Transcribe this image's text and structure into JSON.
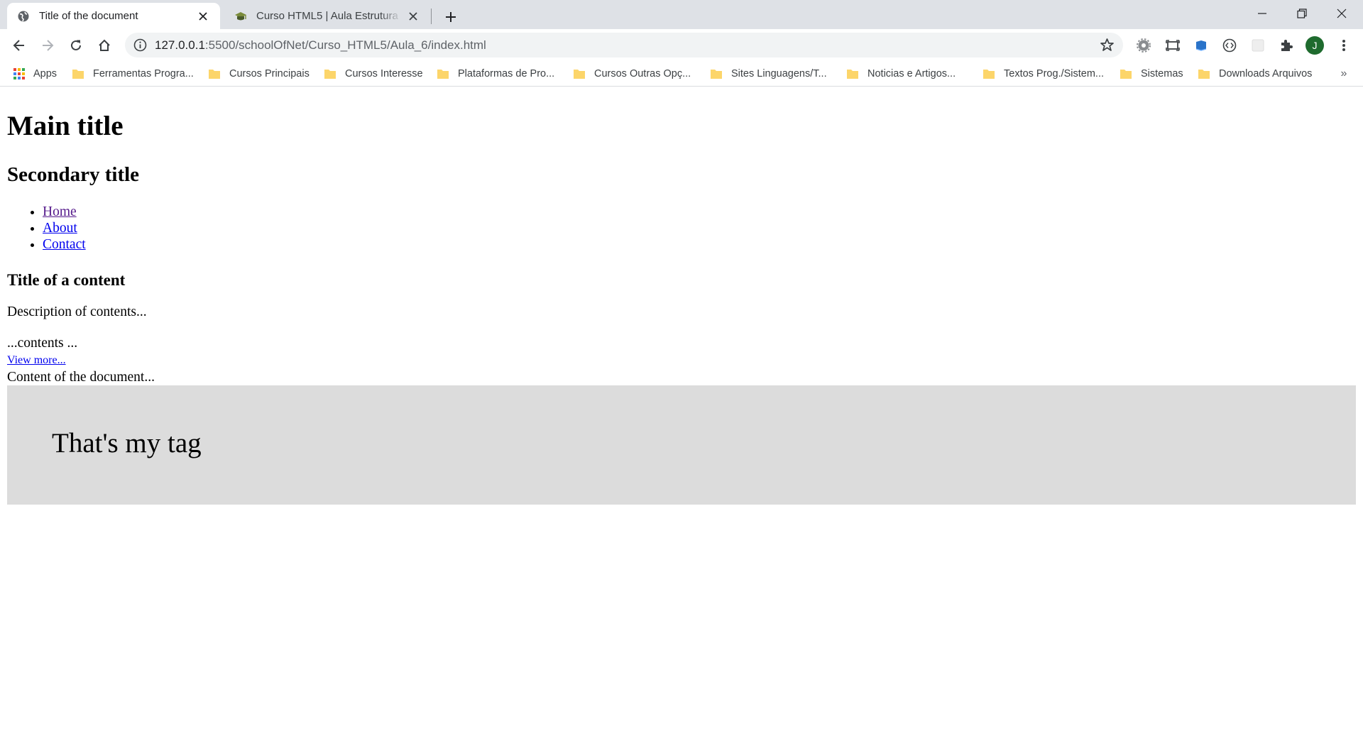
{
  "browser": {
    "tabs": [
      {
        "title": "Title of the document",
        "active": true
      },
      {
        "title": "Curso HTML5 | Aula Estrutura básica",
        "active": false
      }
    ],
    "url_host": "127.0.0.1",
    "url_path": ":5500/schoolOfNet/Curso_HTML5/Aula_6/index.html",
    "profile_initial": "J",
    "colors": {
      "tabstrip": "#dee1e6",
      "profile": "#1e6b2e",
      "omnibox": "#f1f3f4"
    }
  },
  "bookmarks": [
    {
      "label": "Apps",
      "icon": "apps-grid-icon"
    },
    {
      "label": "Ferramentas Progra...",
      "icon": "folder-icon"
    },
    {
      "label": "Cursos Principais",
      "icon": "folder-icon"
    },
    {
      "label": "Cursos Interesse",
      "icon": "folder-icon"
    },
    {
      "label": "Plataformas de Pro...",
      "icon": "folder-icon"
    },
    {
      "label": "Cursos Outras Opç...",
      "icon": "folder-icon"
    },
    {
      "label": "Sites Linguagens/T...",
      "icon": "folder-icon"
    },
    {
      "label": "Noticias e Artigos...",
      "icon": "folder-icon"
    },
    {
      "label": "Textos Prog./Sistem...",
      "icon": "folder-icon"
    },
    {
      "label": "Sistemas",
      "icon": "folder-icon"
    },
    {
      "label": "Downloads Arquivos",
      "icon": "folder-icon"
    }
  ],
  "page": {
    "main_title": "Main title",
    "secondary_title": "Secondary title",
    "nav": [
      {
        "label": "Home",
        "visited": true
      },
      {
        "label": "About",
        "visited": false
      },
      {
        "label": "Contact",
        "visited": false
      }
    ],
    "content_title": "Title of a content",
    "description": "Description of contents...",
    "contents": "...contents ...",
    "view_more": "View more...",
    "document_content": "Content of the document...",
    "my_tag": "That's my tag",
    "my_tag_bg": "#dcdcdc"
  }
}
